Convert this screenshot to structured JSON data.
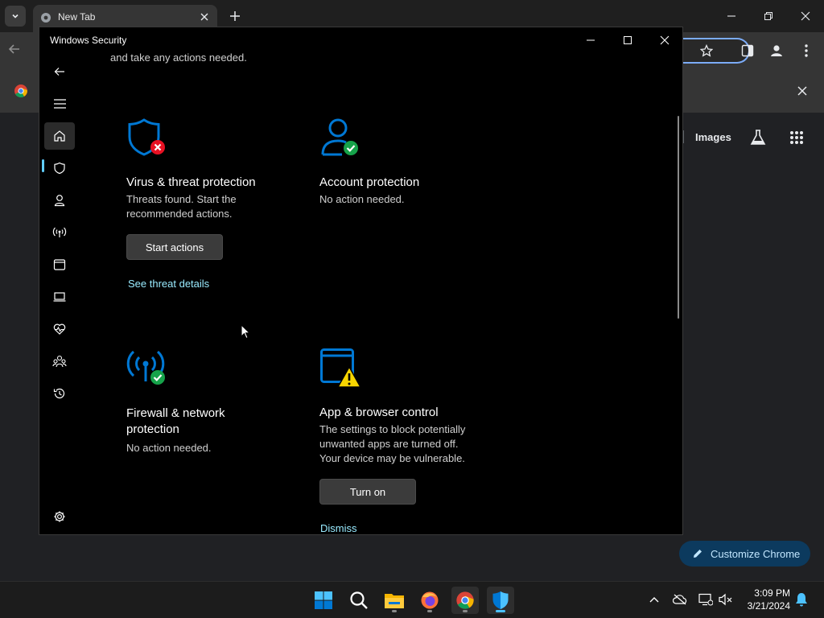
{
  "chrome": {
    "tab_title": "New Tab",
    "images_label": "Images",
    "customize_label": "Customize Chrome"
  },
  "window": {
    "title": "Windows Security",
    "top_text": "and take any actions needed."
  },
  "cards": {
    "virus": {
      "title": "Virus & threat protection",
      "desc": "Threats found. Start the recommended actions.",
      "button": "Start actions",
      "link": "See threat details"
    },
    "account": {
      "title": "Account protection",
      "desc": "No action needed."
    },
    "firewall": {
      "title": "Firewall & network protection",
      "desc": "No action needed."
    },
    "app": {
      "title": "App & browser control",
      "desc": "The settings to block potentially unwanted apps are turned off. Your device may be vulnerable.",
      "button": "Turn on",
      "link": "Dismiss"
    }
  },
  "nav": [
    "back-arrow-icon",
    "hamburger-menu-icon",
    "home-icon",
    "shield-icon",
    "person-icon",
    "wireless-icon",
    "app-browser-icon",
    "laptop-icon",
    "heart-pulse-icon",
    "family-icon",
    "history-icon",
    "settings-gear-icon"
  ],
  "taskbar": {
    "time": "3:09 PM",
    "date": "3/21/2024"
  },
  "colors": {
    "accent_blue": "#0078d4",
    "link": "#99ebff",
    "error_red": "#e81123",
    "ok_green": "#16a34a",
    "warn_yellow": "#f7d500"
  }
}
